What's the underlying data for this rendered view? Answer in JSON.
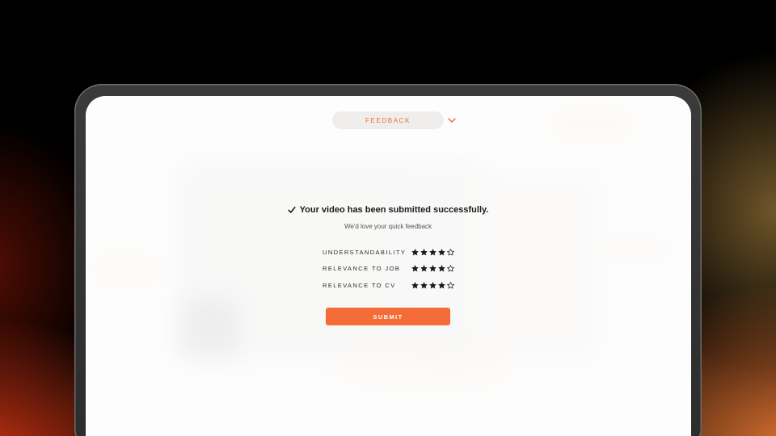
{
  "header": {
    "feedback_label": "FEEDBACK",
    "toggle_icon": "chevron-down-icon"
  },
  "feedback_panel": {
    "success_icon": "check-icon",
    "headline": "Your video has been submitted successfully.",
    "subline": "We'd love your quick feedback",
    "ratings": [
      {
        "label": "UNDERSTANDABILITY",
        "stars": 4,
        "max": 5
      },
      {
        "label": "RELEVANCE TO JOB",
        "stars": 4,
        "max": 5
      },
      {
        "label": "RELEVANCE TO CV",
        "stars": 4,
        "max": 5
      }
    ],
    "submit_label": "SUBMIT"
  },
  "colors": {
    "accent": "#f46c37",
    "star_filled": "#1b1b1b",
    "star_empty": "#1b1b1b"
  }
}
